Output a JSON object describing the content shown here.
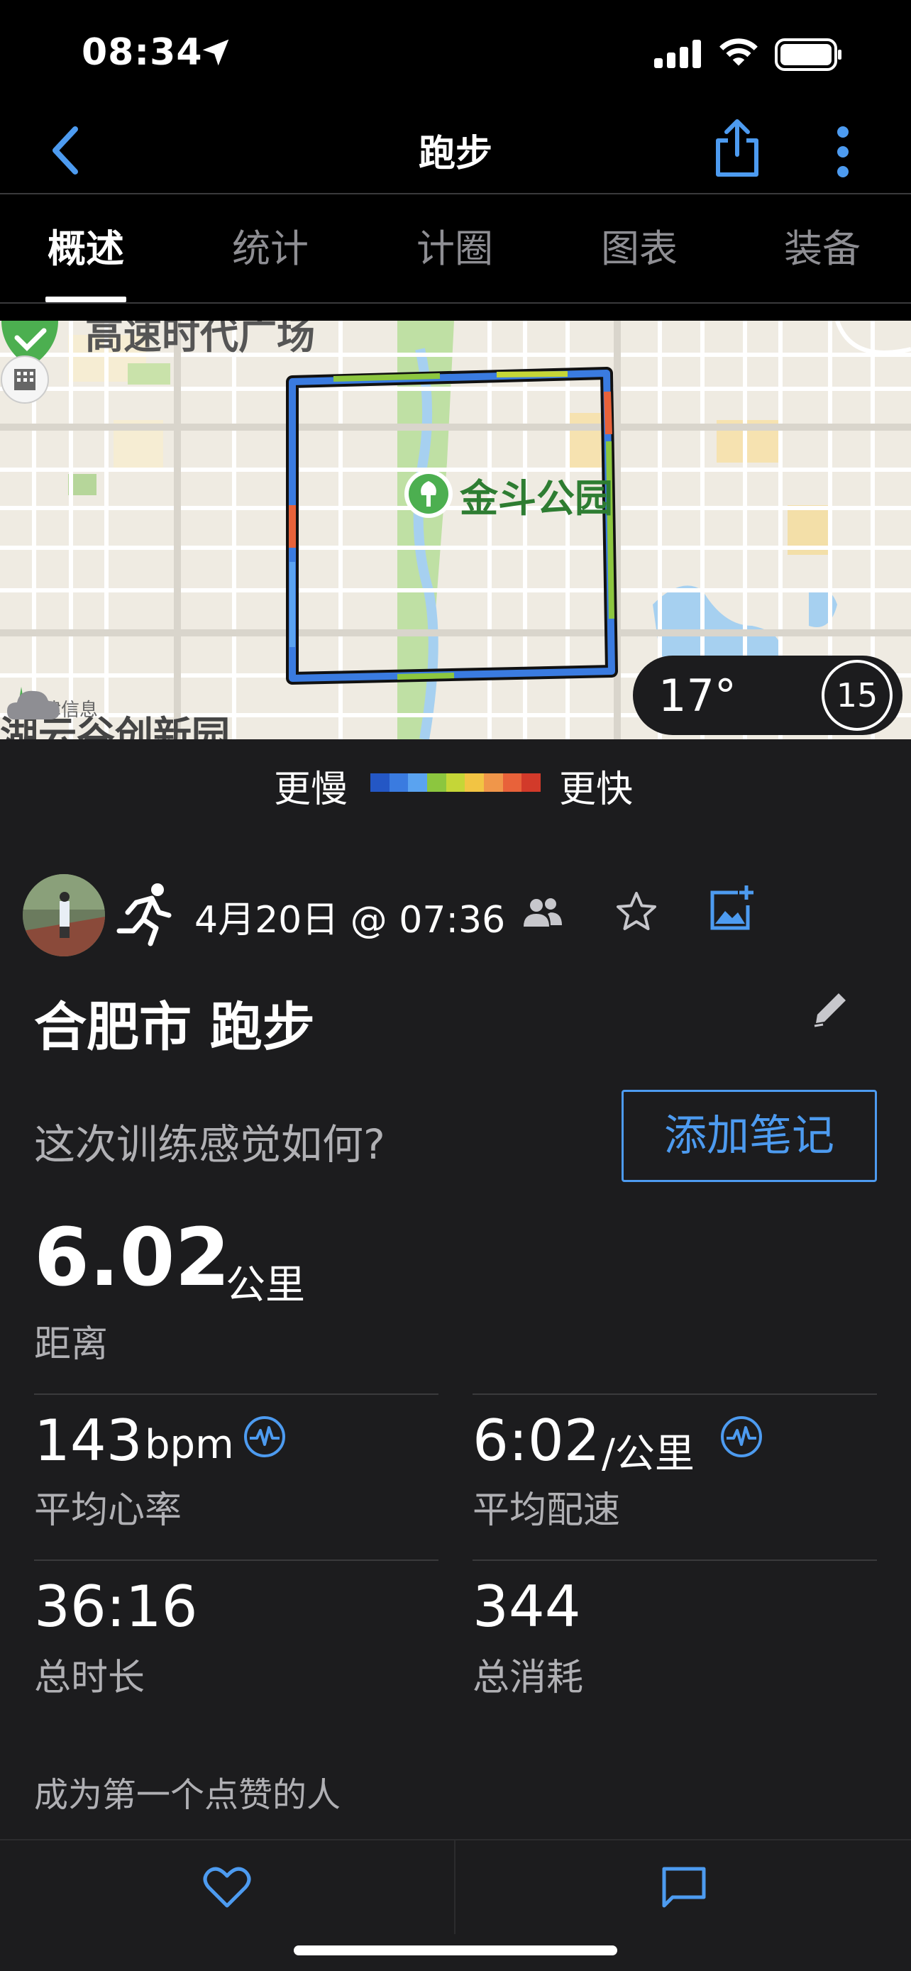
{
  "status_bar": {
    "time": "08:34"
  },
  "nav": {
    "title": "跑步"
  },
  "tabs": [
    {
      "label": "概述",
      "active": true
    },
    {
      "label": "统计",
      "active": false
    },
    {
      "label": "计圈",
      "active": false
    },
    {
      "label": "图表",
      "active": false
    },
    {
      "label": "装备",
      "active": false
    }
  ],
  "map": {
    "park_label": "金斗公园",
    "top_label": "高速时代广场",
    "bottom_label": "湖云谷创新园",
    "legal_text": "法律信息",
    "weather_temp": "17°",
    "minute_badge": "15"
  },
  "pace_legend": {
    "slow_label": "更慢",
    "fast_label": "更快",
    "colors": [
      "#2457c5",
      "#3a7be0",
      "#5aa3f0",
      "#8cc63f",
      "#c5d637",
      "#f2c443",
      "#f0964a",
      "#e8623a",
      "#d23a2a"
    ]
  },
  "activity": {
    "date": "4月20日 @ 07:36",
    "title": "合肥市 跑步",
    "feel_prompt": "这次训练感觉如何?",
    "add_note": "添加笔记",
    "distance": {
      "value": "6.02",
      "unit": "公里",
      "label": "距离"
    },
    "heart_rate": {
      "value": "143",
      "unit": "bpm",
      "label": "平均心率"
    },
    "pace": {
      "value": "6:02",
      "unit": "/公里",
      "label": "平均配速"
    },
    "duration": {
      "value": "36:16",
      "label": "总时长"
    },
    "calories": {
      "value": "344",
      "label": "总消耗"
    },
    "first_like": "成为第一个点赞的人"
  },
  "colors": {
    "accent": "#4d9bf0",
    "background": "#1c1c1e"
  }
}
